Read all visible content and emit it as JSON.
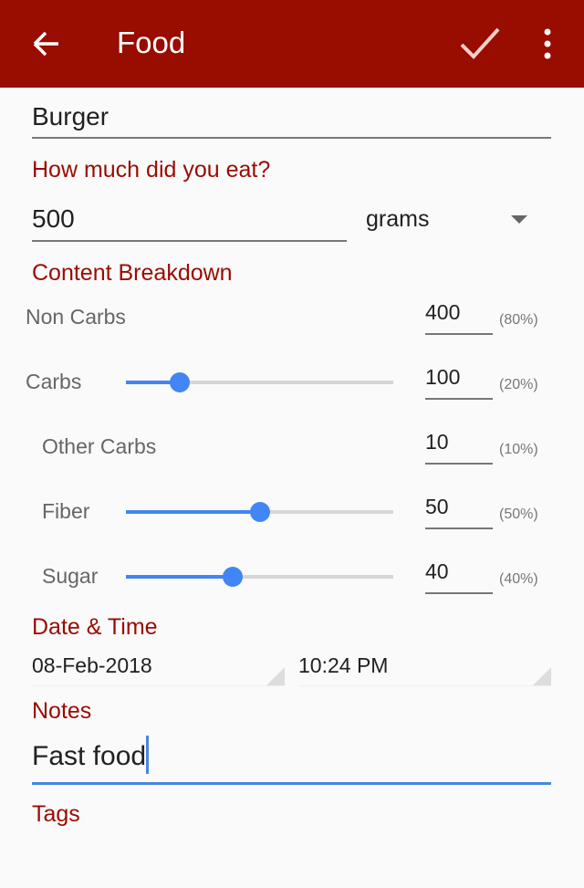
{
  "appbar": {
    "title": "Food",
    "back_icon": "arrow-left-icon",
    "save_icon": "check-icon",
    "menu_icon": "more-vert-icon"
  },
  "food_name": {
    "value": "Burger"
  },
  "amount": {
    "label": "How much did you eat?",
    "value": "500",
    "unit": "grams"
  },
  "breakdown": {
    "label": "Content Breakdown",
    "rows": [
      {
        "label": "Non Carbs",
        "value": "400",
        "percent": "(80%)",
        "slider": null,
        "indent": false
      },
      {
        "label": "Carbs",
        "value": "100",
        "percent": "(20%)",
        "slider": 0.2,
        "indent": false
      },
      {
        "label": "Other Carbs",
        "value": "10",
        "percent": "(10%)",
        "slider": null,
        "indent": true
      },
      {
        "label": "Fiber",
        "value": "50",
        "percent": "(50%)",
        "slider": 0.5,
        "indent": true
      },
      {
        "label": "Sugar",
        "value": "40",
        "percent": "(40%)",
        "slider": 0.4,
        "indent": true
      }
    ]
  },
  "datetime": {
    "label": "Date & Time",
    "date": "08-Feb-2018",
    "time": "10:24 PM"
  },
  "notes": {
    "label": "Notes",
    "value": "Fast food"
  },
  "tags": {
    "label": "Tags"
  },
  "colors": {
    "accent": "#990c00",
    "slider": "#4285f4"
  }
}
